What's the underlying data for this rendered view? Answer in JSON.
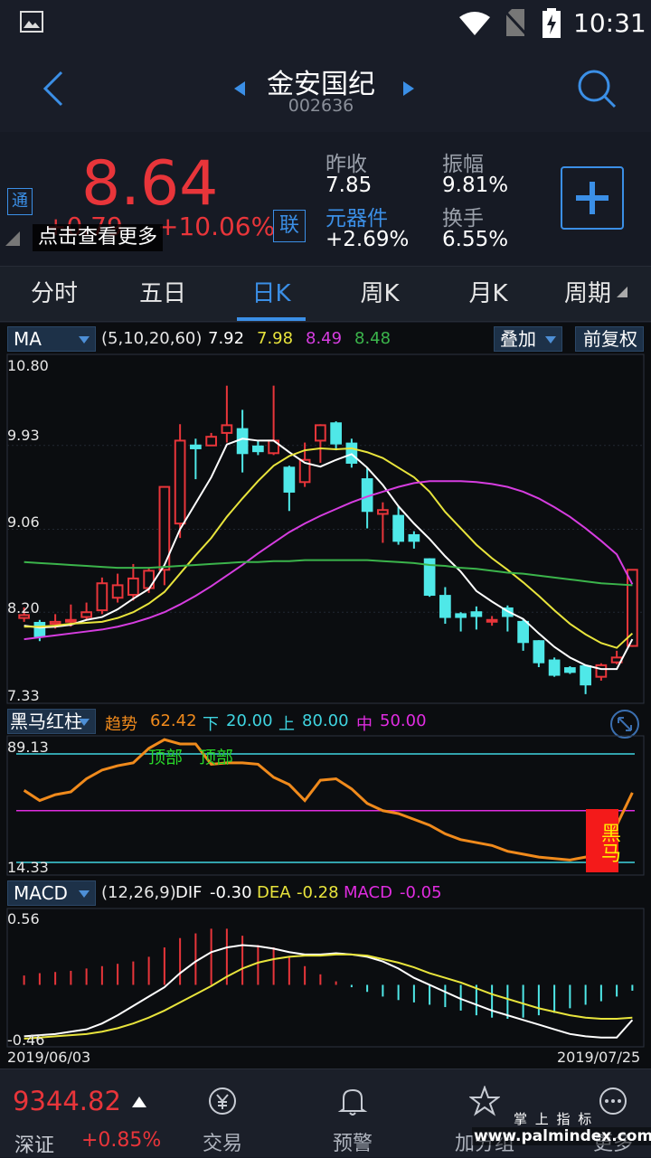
{
  "status_bar": {
    "time": "10:31"
  },
  "header": {
    "stock_name": "金安国纪",
    "stock_code": "002636"
  },
  "quote": {
    "price": "8.64",
    "change": "+0.79",
    "change_pct": "+10.06%",
    "tong_badge": "通",
    "lian_badge": "联",
    "tooltip": "点击查看更多",
    "stats": [
      {
        "label": "昨收",
        "value": "7.85"
      },
      {
        "label": "振幅",
        "value": "9.81%"
      },
      {
        "label": "元器件",
        "value": "+2.69%"
      },
      {
        "label": "换手",
        "value": "6.55%"
      }
    ],
    "colors": {
      "up": "#e8353a",
      "link": "#3b8fe6"
    }
  },
  "tabs": [
    {
      "label": "分时"
    },
    {
      "label": "五日"
    },
    {
      "label": "日K"
    },
    {
      "label": "周K"
    },
    {
      "label": "月K"
    },
    {
      "label": "周期"
    }
  ],
  "ma_bar": {
    "indicator": "MA",
    "params": "(5,10,20,60)",
    "ma5": "7.92",
    "ma10": "7.98",
    "ma20": "8.49",
    "ma60": "8.48",
    "overlay_btn": "叠加",
    "adjust_btn": "前复权"
  },
  "hm_bar": {
    "indicator": "黑马红柱",
    "trend_label": "趋势",
    "trend_val": "62.42",
    "down_label": "下",
    "down_val": "20.00",
    "up_label": "上",
    "up_val": "80.00",
    "mid_label": "中",
    "mid_val": "50.00",
    "top_marker_1": "顶部",
    "top_marker_2": "顶部",
    "dark_horse": "黑马",
    "axis_max": "89.13",
    "axis_min": "14.33"
  },
  "macd_bar": {
    "indicator": "MACD",
    "params": "(12,26,9)",
    "dif_label": "DIF",
    "dif_val": "-0.30",
    "dea_label": "DEA",
    "dea_val": "-0.28",
    "macd_label": "MACD",
    "macd_val": "-0.05",
    "axis_max": "0.56",
    "axis_min": "-0.46",
    "date_start": "2019/06/03",
    "date_end": "2019/07/25"
  },
  "chart_data": [
    {
      "type": "candlestick",
      "title": "",
      "y_ticks": [
        "10.80",
        "9.93",
        "9.06",
        "8.20",
        "7.33"
      ],
      "ylim": [
        7.33,
        10.8
      ],
      "x_range": [
        "2019/06/03",
        "2019/07/25"
      ],
      "candles": [
        {
          "o": 8.14,
          "c": 8.17,
          "h": 8.25,
          "l": 8.1
        },
        {
          "o": 8.09,
          "c": 7.95,
          "h": 8.12,
          "l": 7.9
        },
        {
          "o": 8.08,
          "c": 8.1,
          "h": 8.18,
          "l": 8.03
        },
        {
          "o": 8.12,
          "c": 8.12,
          "h": 8.28,
          "l": 8.05
        },
        {
          "o": 8.15,
          "c": 8.2,
          "h": 8.3,
          "l": 8.12
        },
        {
          "o": 8.22,
          "c": 8.5,
          "h": 8.56,
          "l": 8.18
        },
        {
          "o": 8.35,
          "c": 8.48,
          "h": 8.6,
          "l": 8.3
        },
        {
          "o": 8.38,
          "c": 8.55,
          "h": 8.7,
          "l": 8.32
        },
        {
          "o": 8.45,
          "c": 8.63,
          "h": 8.66,
          "l": 8.4
        },
        {
          "o": 8.64,
          "c": 9.5,
          "h": 9.5,
          "l": 8.48
        },
        {
          "o": 9.12,
          "c": 9.98,
          "h": 10.15,
          "l": 8.97
        },
        {
          "o": 9.93,
          "c": 9.9,
          "h": 10.0,
          "l": 9.58
        },
        {
          "o": 9.93,
          "c": 10.02,
          "h": 10.06,
          "l": 9.95
        },
        {
          "o": 10.06,
          "c": 10.14,
          "h": 10.55,
          "l": 9.96
        },
        {
          "o": 10.1,
          "c": 9.85,
          "h": 10.3,
          "l": 9.65
        },
        {
          "o": 9.92,
          "c": 9.87,
          "h": 9.98,
          "l": 9.83
        },
        {
          "o": 9.85,
          "c": 9.98,
          "h": 10.55,
          "l": 9.83
        },
        {
          "o": 9.7,
          "c": 9.45,
          "h": 9.72,
          "l": 9.25
        },
        {
          "o": 9.55,
          "c": 9.78,
          "h": 9.96,
          "l": 9.5
        },
        {
          "o": 9.98,
          "c": 10.14,
          "h": 10.15,
          "l": 9.75
        },
        {
          "o": 10.16,
          "c": 9.95,
          "h": 10.18,
          "l": 9.88
        },
        {
          "o": 9.95,
          "c": 9.75,
          "h": 10.0,
          "l": 9.7
        },
        {
          "o": 9.58,
          "c": 9.25,
          "h": 9.7,
          "l": 9.07
        },
        {
          "o": 9.22,
          "c": 9.26,
          "h": 9.34,
          "l": 8.92
        },
        {
          "o": 9.2,
          "c": 8.94,
          "h": 9.3,
          "l": 8.9
        },
        {
          "o": 9.0,
          "c": 8.94,
          "h": 9.04,
          "l": 8.86
        },
        {
          "o": 8.75,
          "c": 8.38,
          "h": 8.76,
          "l": 8.36
        },
        {
          "o": 8.37,
          "c": 8.15,
          "h": 8.46,
          "l": 8.08
        },
        {
          "o": 8.18,
          "c": 8.15,
          "h": 8.2,
          "l": 8.0
        },
        {
          "o": 8.2,
          "c": 8.16,
          "h": 8.26,
          "l": 8.02
        },
        {
          "o": 8.12,
          "c": 8.12,
          "h": 8.16,
          "l": 8.06
        },
        {
          "o": 8.24,
          "c": 8.16,
          "h": 8.27,
          "l": 8.0
        },
        {
          "o": 8.1,
          "c": 7.89,
          "h": 8.13,
          "l": 7.8
        },
        {
          "o": 7.9,
          "c": 7.68,
          "h": 7.91,
          "l": 7.63
        },
        {
          "o": 7.7,
          "c": 7.55,
          "h": 7.73,
          "l": 7.53
        },
        {
          "o": 7.62,
          "c": 7.58,
          "h": 7.64,
          "l": 7.56
        },
        {
          "o": 7.64,
          "c": 7.45,
          "h": 7.65,
          "l": 7.35
        },
        {
          "o": 7.53,
          "c": 7.65,
          "h": 7.67,
          "l": 7.49
        },
        {
          "o": 7.68,
          "c": 7.73,
          "h": 7.8,
          "l": 7.66
        },
        {
          "o": 7.85,
          "c": 8.64,
          "h": 8.64,
          "l": 7.84
        }
      ],
      "series": [
        {
          "name": "MA5",
          "color": "#ffffff",
          "values": [
            8.06,
            8.04,
            8.05,
            8.07,
            8.12,
            8.15,
            8.23,
            8.34,
            8.44,
            8.69,
            9.06,
            9.33,
            9.6,
            9.94,
            10.0,
            9.98,
            9.98,
            9.86,
            9.75,
            9.71,
            9.78,
            9.84,
            9.7,
            9.52,
            9.3,
            9.12,
            8.96,
            8.78,
            8.62,
            8.42,
            8.31,
            8.21,
            8.13,
            7.98,
            7.84,
            7.73,
            7.65,
            7.61,
            7.61,
            7.92
          ]
        },
        {
          "name": "MA10",
          "color": "#e8e43c",
          "values": [
            8.05,
            8.05,
            8.06,
            8.08,
            8.09,
            8.1,
            8.14,
            8.2,
            8.29,
            8.41,
            8.6,
            8.79,
            8.97,
            9.19,
            9.38,
            9.56,
            9.72,
            9.82,
            9.88,
            9.9,
            9.89,
            9.9,
            9.86,
            9.8,
            9.7,
            9.6,
            9.45,
            9.24,
            9.07,
            8.9,
            8.76,
            8.64,
            8.51,
            8.37,
            8.22,
            8.08,
            7.97,
            7.88,
            7.83,
            7.98
          ]
        },
        {
          "name": "MA20",
          "color": "#d63de0",
          "values": [
            7.92,
            7.94,
            7.96,
            7.98,
            8.0,
            8.02,
            8.05,
            8.09,
            8.14,
            8.2,
            8.28,
            8.37,
            8.47,
            8.58,
            8.69,
            8.81,
            8.92,
            9.03,
            9.12,
            9.2,
            9.27,
            9.34,
            9.4,
            9.45,
            9.5,
            9.54,
            9.56,
            9.56,
            9.56,
            9.55,
            9.53,
            9.5,
            9.45,
            9.38,
            9.29,
            9.19,
            9.07,
            8.94,
            8.8,
            8.49
          ]
        },
        {
          "name": "MA60",
          "color": "#3bb44b",
          "values": [
            8.72,
            8.71,
            8.7,
            8.69,
            8.68,
            8.67,
            8.66,
            8.66,
            8.66,
            8.67,
            8.68,
            8.69,
            8.7,
            8.71,
            8.72,
            8.72,
            8.73,
            8.73,
            8.74,
            8.74,
            8.74,
            8.74,
            8.74,
            8.73,
            8.72,
            8.71,
            8.69,
            8.68,
            8.66,
            8.65,
            8.63,
            8.61,
            8.6,
            8.58,
            8.56,
            8.54,
            8.52,
            8.5,
            8.49,
            8.48
          ]
        }
      ]
    },
    {
      "type": "line",
      "title": "",
      "ylim": [
        14.33,
        89.13
      ],
      "y_ticks": [
        "89.13",
        "14.33"
      ],
      "reference_lines": [
        {
          "name": "上",
          "value": 80,
          "color": "#3fd4e0"
        },
        {
          "name": "中",
          "value": 50,
          "color": "#e02ce0"
        },
        {
          "name": "下",
          "value": 20,
          "color": "#3fd4e0"
        }
      ],
      "series": [
        {
          "name": "趋势",
          "color": "#f08a1c",
          "values": [
            64,
            57,
            61,
            63,
            72,
            78,
            81,
            83,
            93,
            99,
            96,
            96,
            82,
            83,
            83,
            82,
            73,
            68,
            57,
            71,
            72,
            65,
            55,
            50,
            48,
            44,
            40,
            34,
            30,
            28,
            26,
            22,
            20,
            18,
            17,
            16,
            18,
            20,
            40,
            62.42
          ]
        }
      ],
      "annotations": [
        {
          "text": "顶部"
        },
        {
          "text": "顶部"
        },
        {
          "text": "黑马"
        }
      ]
    },
    {
      "type": "bar+line",
      "title": "",
      "ylim": [
        -0.46,
        0.56
      ],
      "y_ticks": [
        "0.56",
        "-0.46"
      ],
      "series": [
        {
          "name": "MACD",
          "kind": "bar",
          "values": [
            0.08,
            0.1,
            0.11,
            0.12,
            0.14,
            0.16,
            0.18,
            0.2,
            0.24,
            0.32,
            0.4,
            0.44,
            0.48,
            0.48,
            0.42,
            0.34,
            0.32,
            0.24,
            0.16,
            0.09,
            0.03,
            -0.02,
            -0.06,
            -0.1,
            -0.13,
            -0.15,
            -0.17,
            -0.19,
            -0.22,
            -0.26,
            -0.28,
            -0.29,
            -0.28,
            -0.26,
            -0.24,
            -0.2,
            -0.17,
            -0.14,
            -0.1,
            -0.05
          ]
        },
        {
          "name": "DIF",
          "kind": "line",
          "color": "#ffffff",
          "values": [
            -0.44,
            -0.43,
            -0.42,
            -0.4,
            -0.38,
            -0.33,
            -0.26,
            -0.18,
            -0.1,
            -0.02,
            0.1,
            0.2,
            0.28,
            0.32,
            0.34,
            0.33,
            0.31,
            0.28,
            0.26,
            0.26,
            0.27,
            0.26,
            0.24,
            0.2,
            0.14,
            0.06,
            0.0,
            -0.06,
            -0.12,
            -0.17,
            -0.22,
            -0.26,
            -0.3,
            -0.34,
            -0.38,
            -0.42,
            -0.44,
            -0.45,
            -0.45,
            -0.3
          ]
        },
        {
          "name": "DEA",
          "kind": "line",
          "color": "#e8e43c",
          "values": [
            -0.46,
            -0.45,
            -0.44,
            -0.43,
            -0.42,
            -0.4,
            -0.37,
            -0.33,
            -0.28,
            -0.22,
            -0.15,
            -0.08,
            -0.01,
            0.07,
            0.14,
            0.19,
            0.22,
            0.24,
            0.25,
            0.25,
            0.26,
            0.26,
            0.25,
            0.22,
            0.19,
            0.15,
            0.1,
            0.06,
            0.02,
            -0.03,
            -0.08,
            -0.12,
            -0.16,
            -0.2,
            -0.23,
            -0.26,
            -0.28,
            -0.29,
            -0.29,
            -0.28
          ]
        }
      ]
    }
  ],
  "bottom_bar": {
    "index_value": "9344.82",
    "index_name": "深证",
    "index_change": "+0.85%",
    "items": [
      {
        "label": "交易"
      },
      {
        "label": "预警"
      },
      {
        "label": "加分组"
      },
      {
        "label": "更多"
      }
    ],
    "watermark_top": "掌 上 指 标",
    "watermark_url": "www.palmindex.com"
  }
}
